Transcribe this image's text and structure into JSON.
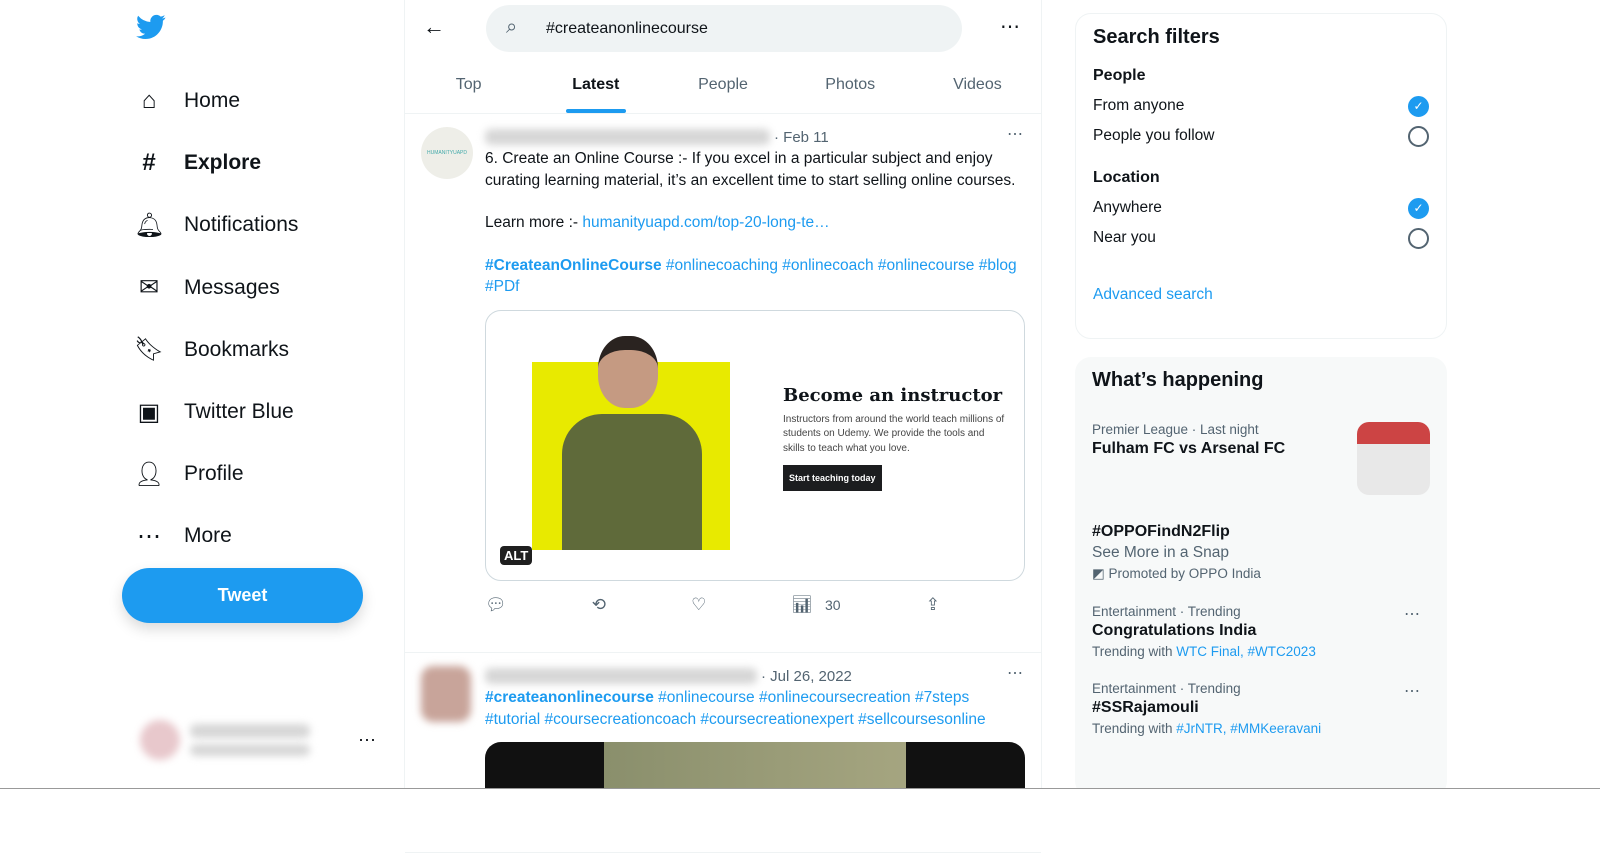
{
  "nav": {
    "items": [
      {
        "label": "Home",
        "icon": "home-icon"
      },
      {
        "label": "Explore",
        "icon": "hashtag-icon"
      },
      {
        "label": "Notifications",
        "icon": "bell-icon"
      },
      {
        "label": "Messages",
        "icon": "envelope-icon"
      },
      {
        "label": "Bookmarks",
        "icon": "bookmark-icon"
      },
      {
        "label": "Twitter Blue",
        "icon": "twitter-blue-icon"
      },
      {
        "label": "Profile",
        "icon": "person-icon"
      },
      {
        "label": "More",
        "icon": "more-circle-icon"
      }
    ],
    "active": "Explore",
    "tweet_label": "Tweet"
  },
  "search": {
    "value": "#createanonlinecourse"
  },
  "tabs": [
    "Top",
    "Latest",
    "People",
    "Photos",
    "Videos"
  ],
  "active_tab": "Latest",
  "tweets": [
    {
      "date": "· Feb 11",
      "text": "6. Create an Online Course :- If you excel in a particular subject and enjoy curating learning material, it’s an excellent time to start selling online courses.",
      "learn_prefix": "Learn more :- ",
      "link": "humanityuapd.com/top-20-long-te…",
      "hashtag_bold": "#CreateanOnlineCourse",
      "hashtags": " #onlinecoaching #onlinecoach #onlinecourse #blog #PDf",
      "card": {
        "title": "Become an instructor",
        "desc": "Instructors from around the world teach millions of students on Udemy. We provide the tools and skills to teach what you love.",
        "button": "Start teaching today",
        "alt": "ALT"
      },
      "views": "30",
      "avatar_text": "HUMANITYUAPD"
    },
    {
      "date": "· Jul 26, 2022",
      "hashtag_bold": "#createanonlinecourse",
      "hashtags": " #onlinecourse #onlinecoursecreation #7steps #tutorial #coursecreationcoach #coursecreationexpert #sellcoursesonline"
    }
  ],
  "filters": {
    "title": "Search filters",
    "people": "People",
    "from_anyone": "From anyone",
    "people_follow": "People you follow",
    "location": "Location",
    "anywhere": "Anywhere",
    "near_you": "Near you",
    "advanced": "Advanced search"
  },
  "happening": {
    "title": "What’s happening",
    "trends": [
      {
        "meta": "Premier League · Last night",
        "title": "Fulham FC vs Arsenal FC"
      },
      {
        "title": "#OPPOFindN2Flip",
        "sub": "See More in a Snap",
        "meta": "Promoted by OPPO India"
      },
      {
        "meta": "Entertainment · Trending",
        "title": "Congratulations India",
        "with": "Trending with ",
        "links": "WTC Final, #WTC2023"
      },
      {
        "meta": "Entertainment · Trending",
        "title": "#SSRajamouli",
        "with": "Trending with ",
        "links": "#JrNTR, #MMKeeravani"
      }
    ]
  },
  "colors": {
    "accent": "#1d9bf0",
    "text": "#0f1419",
    "muted": "#536471"
  }
}
